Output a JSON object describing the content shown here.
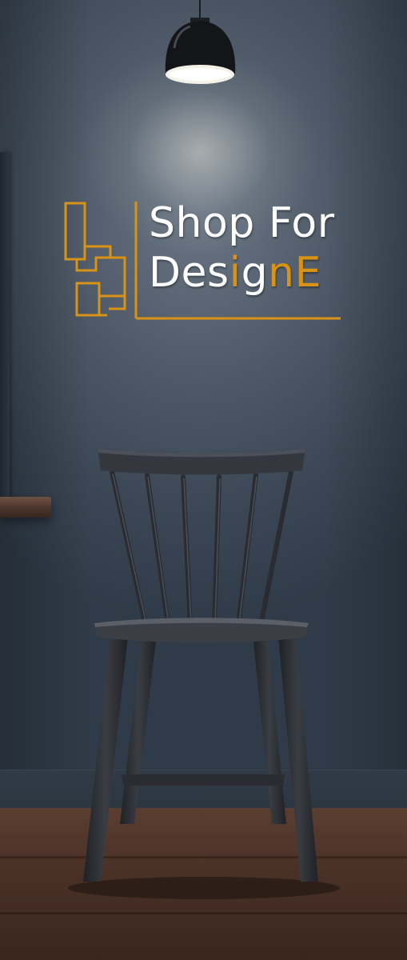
{
  "logo": {
    "line1": "Shop For",
    "line2_start": "Des",
    "line2_i": "i",
    "line2_g": "g",
    "line2_n": "n",
    "line2_e": "E"
  },
  "colors": {
    "wall": "#4b5765",
    "accent": "#d89317",
    "text": "#ffffff",
    "chair": "#2a2c30",
    "floor": "#4a3127"
  },
  "scene_objects": [
    "pendant-lamp",
    "wall-logo",
    "spindle-chair",
    "side-desk",
    "wooden-floor"
  ]
}
